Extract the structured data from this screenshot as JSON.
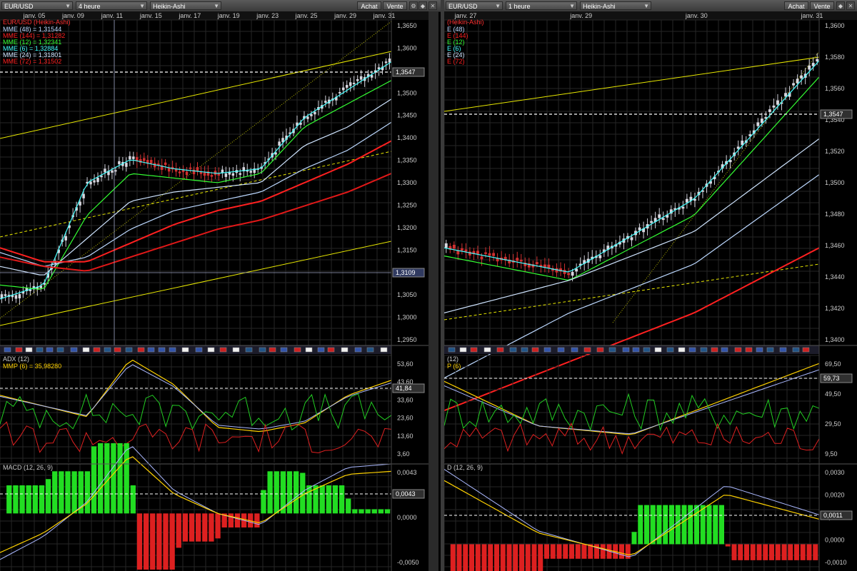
{
  "left": {
    "symbol": "EUR/USD",
    "timeframe": "4 heure",
    "chart_style": "Heikin-Ashi",
    "buy_label": "Achat",
    "sell_label": "Vente",
    "dates": [
      "janv. 05",
      "janv. 09",
      "janv. 11",
      "janv. 15",
      "janv. 17",
      "janv. 19",
      "janv. 23",
      "janv. 25",
      "janv. 29",
      "janv. 31"
    ],
    "price_title": "EUR/USD (Heikin-Ashi)",
    "legend": [
      {
        "text": "MME (48) = 1,31544",
        "color": "#bcd8ff"
      },
      {
        "text": "MME (144) = 1,31282",
        "color": "#ff2020"
      },
      {
        "text": "MME (12) = 1,32341",
        "color": "#33ff33"
      },
      {
        "text": "MME (6) = 1,32884",
        "color": "#44ffff"
      },
      {
        "text": "MME (24) = 1,31801",
        "color": "#cfe4ff"
      },
      {
        "text": "MME (72) = 1,31502",
        "color": "#ff2020"
      }
    ],
    "price_ticks": [
      "1,3650",
      "1,3600",
      "1,3550",
      "1,3500",
      "1,3450",
      "1,3400",
      "1,3350",
      "1,3300",
      "1,3250",
      "1,3200",
      "1,3150",
      "1,3100",
      "1,3050",
      "1,3000",
      "1,2950"
    ],
    "price_marker": "1,3547",
    "cross_marker": "1,3109",
    "adx_title": "ADX (12)",
    "mmp_title": "MMP (6) = 35,98280",
    "adx_ticks": [
      "53,60",
      "43,60",
      "33,60",
      "23,60",
      "13,60",
      "3,60"
    ],
    "adx_marker": "41,84",
    "macd_title": "MACD (12, 26, 9)",
    "macd_ticks": [
      "0,0043",
      "0,0000",
      "-0,0050"
    ],
    "macd_marker": "0,0043"
  },
  "right": {
    "symbol": "EUR/USD",
    "timeframe": "1 heure",
    "chart_style": "Heikin-Ashi",
    "buy_label": "Achat",
    "sell_label": "Vente",
    "dates": [
      "janv. 27",
      "janv. 29",
      "janv. 30",
      "janv. 31"
    ],
    "price_title": "(Heikin-Ashi)",
    "legend": [
      {
        "text": "E (48)",
        "color": "#bcd8ff"
      },
      {
        "text": "E (144)",
        "color": "#ff2020"
      },
      {
        "text": "E (12)",
        "color": "#33ff33"
      },
      {
        "text": "E (6)",
        "color": "#44ffff"
      },
      {
        "text": "E (24)",
        "color": "#cfe4ff"
      },
      {
        "text": "E (72)",
        "color": "#ff2020"
      }
    ],
    "price_ticks": [
      "1,3600",
      "1,3580",
      "1,3560",
      "1,3540",
      "1,3520",
      "1,3500",
      "1,3480",
      "1,3460",
      "1,3440",
      "1,3420",
      "1,3400"
    ],
    "price_marker": "1,3547",
    "adx_title": "(12)",
    "mmp_title": "P (6)",
    "adx_ticks": [
      "69,50",
      "49,50",
      "29,50",
      "9,50"
    ],
    "adx_marker": "59,73",
    "macd_title": "D (12, 26, 9)",
    "macd_ticks": [
      "0,0030",
      "0,0020",
      "0,0011",
      "0,0000",
      "-0,0010"
    ],
    "macd_marker": "0,0011"
  },
  "chart_data": [
    {
      "type": "line",
      "title": "EUR/USD (Heikin-Ashi)",
      "timeframe": "4 heure",
      "x": [
        "janv. 05",
        "janv. 09",
        "janv. 11",
        "janv. 15",
        "janv. 17",
        "janv. 19",
        "janv. 23",
        "janv. 25",
        "janv. 29",
        "janv. 31"
      ],
      "ylim": [
        1.295,
        1.365
      ],
      "series": [
        {
          "name": "MME (6)",
          "values": [
            1.305,
            1.308,
            1.33,
            1.335,
            1.333,
            1.332,
            1.333,
            1.344,
            1.35,
            1.356
          ]
        },
        {
          "name": "MME (12)",
          "values": [
            1.308,
            1.307,
            1.323,
            1.332,
            1.331,
            1.33,
            1.332,
            1.342,
            1.347,
            1.352
          ]
        },
        {
          "name": "MME (24)",
          "values": [
            1.312,
            1.31,
            1.318,
            1.326,
            1.328,
            1.329,
            1.33,
            1.338,
            1.342,
            1.348
          ]
        },
        {
          "name": "MME (48)",
          "values": [
            1.315,
            1.312,
            1.314,
            1.32,
            1.324,
            1.326,
            1.328,
            1.333,
            1.337,
            1.343
          ]
        },
        {
          "name": "MME (72)",
          "values": [
            1.316,
            1.313,
            1.313,
            1.317,
            1.321,
            1.324,
            1.326,
            1.33,
            1.334,
            1.339
          ]
        },
        {
          "name": "MME (144)",
          "values": [
            1.314,
            1.312,
            1.311,
            1.314,
            1.317,
            1.32,
            1.322,
            1.325,
            1.328,
            1.332
          ]
        }
      ],
      "adx": {
        "ylim": [
          3.6,
          53.6
        ],
        "values": [
          35,
          30,
          25,
          52,
          40,
          20,
          18,
          22,
          35,
          42
        ]
      },
      "macd": {
        "ylim": [
          -0.005,
          0.0043
        ],
        "values": [
          -0.004,
          -0.002,
          0.001,
          0.006,
          0.002,
          0.0,
          -0.001,
          0.002,
          0.004,
          0.0043
        ]
      }
    },
    {
      "type": "line",
      "title": "(Heikin-Ashi)",
      "timeframe": "1 heure",
      "x": [
        "janv. 27",
        "janv. 29",
        "janv. 30",
        "janv. 31"
      ],
      "ylim": [
        1.34,
        1.36
      ],
      "series": [
        {
          "name": "E (6)",
          "values": [
            1.346,
            1.3445,
            1.349,
            1.3575
          ]
        },
        {
          "name": "E (12)",
          "values": [
            1.3455,
            1.344,
            1.348,
            1.3565
          ]
        },
        {
          "name": "E (24)",
          "values": [
            1.342,
            1.344,
            1.347,
            1.3527
          ]
        },
        {
          "name": "E (72)",
          "values": [
            1.338,
            1.342,
            1.345,
            1.3505
          ]
        },
        {
          "name": "E (144)",
          "values": [
            1.336,
            1.339,
            1.342,
            1.346
          ]
        }
      ],
      "adx": {
        "ylim": [
          9.5,
          69.5
        ],
        "values": [
          55,
          30,
          25,
          45,
          65
        ]
      },
      "macd": {
        "ylim": [
          -0.001,
          0.003
        ],
        "values": [
          0.0028,
          0.0005,
          -0.0005,
          0.0022,
          0.0011
        ]
      }
    }
  ]
}
